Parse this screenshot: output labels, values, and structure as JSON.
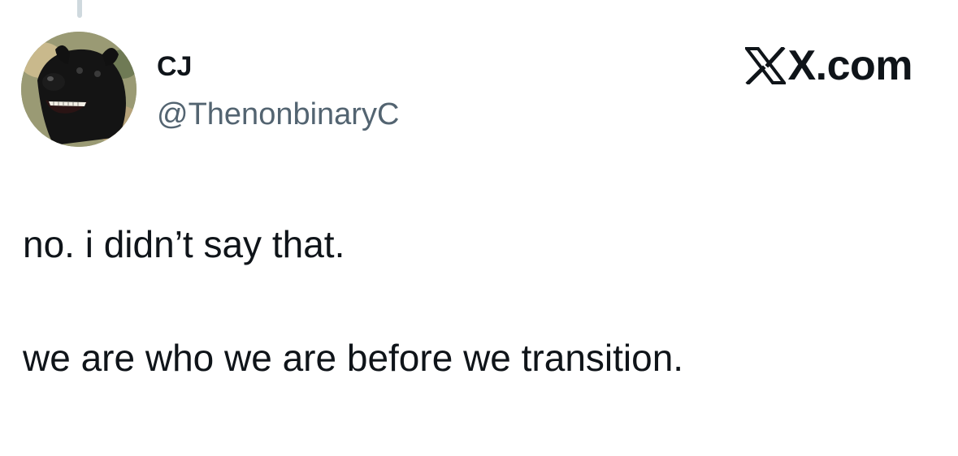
{
  "author": {
    "display_name": "CJ",
    "handle": "@ThenonbinaryC"
  },
  "brand": {
    "text": "X.com",
    "icon": "x-logo-icon"
  },
  "tweet": {
    "lines": [
      "no. i didn’t say that.",
      "we are who we are before we transition."
    ]
  },
  "colors": {
    "text": "#0f1419",
    "secondary_text": "#536471",
    "thread_line": "#cfd9de",
    "background": "#ffffff"
  }
}
